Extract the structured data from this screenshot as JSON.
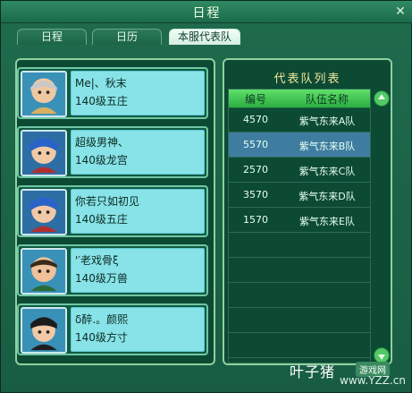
{
  "window": {
    "title": "日程",
    "close_icon": "close-icon"
  },
  "tabs": [
    {
      "label": "日程",
      "active": false
    },
    {
      "label": "日历",
      "active": false
    },
    {
      "label": "本服代表队",
      "active": true
    }
  ],
  "members": [
    {
      "name": "Me|、秋末",
      "level": "140级五庄"
    },
    {
      "name": "超级男神、",
      "level": "140级龙宫"
    },
    {
      "name": "你若只如初见",
      "level": "140级五庄"
    },
    {
      "name": "'′老戏骨ξ",
      "level": "140级万兽"
    },
    {
      "name": "δ醉.。颜熙",
      "level": "140级方寸"
    }
  ],
  "team_list": {
    "title": "代表队列表",
    "headers": {
      "id": "编号",
      "name": "队伍名称"
    },
    "rows": [
      {
        "id": "4570",
        "name": "紫气东来A队",
        "selected": false
      },
      {
        "id": "5570",
        "name": "紫气东来B队",
        "selected": true
      },
      {
        "id": "2570",
        "name": "紫气东来C队",
        "selected": false
      },
      {
        "id": "3570",
        "name": "紫气东来D队",
        "selected": false
      },
      {
        "id": "1570",
        "name": "紫气东来E队",
        "selected": false
      },
      {
        "id": "",
        "name": "",
        "selected": false
      },
      {
        "id": "",
        "name": "",
        "selected": false
      },
      {
        "id": "",
        "name": "",
        "selected": false
      },
      {
        "id": "",
        "name": "",
        "selected": false
      }
    ]
  },
  "watermark": {
    "logo": "叶子猪",
    "site": "游戏网",
    "url": "www.YZZ.cn"
  },
  "colors": {
    "panel_border": "#8fd0a0",
    "info_bg": "#88e3e8",
    "header_green": "#2cae42",
    "selected_row": "#3f7da0",
    "list_title": "#f2e59b"
  }
}
